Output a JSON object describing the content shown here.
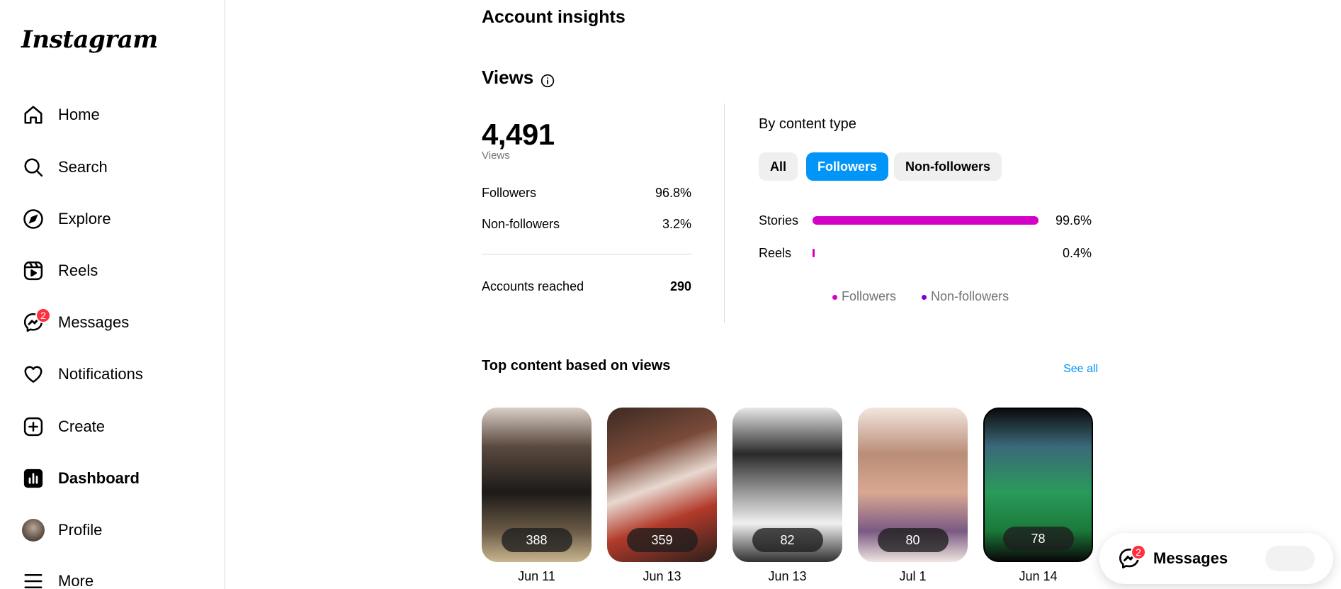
{
  "app": {
    "logo_text": "Instagram"
  },
  "sidebar": {
    "items": [
      {
        "label": "Home",
        "icon": "home-icon"
      },
      {
        "label": "Search",
        "icon": "search-icon"
      },
      {
        "label": "Explore",
        "icon": "compass-icon"
      },
      {
        "label": "Reels",
        "icon": "reels-icon"
      },
      {
        "label": "Messages",
        "icon": "messenger-icon",
        "badge": "2"
      },
      {
        "label": "Notifications",
        "icon": "heart-icon"
      },
      {
        "label": "Create",
        "icon": "plus-square-icon"
      },
      {
        "label": "Dashboard",
        "icon": "bar-chart-icon",
        "active": true
      },
      {
        "label": "Profile",
        "icon": "avatar"
      },
      {
        "label": "More",
        "icon": "menu-icon"
      }
    ]
  },
  "main": {
    "title": "Account insights",
    "views": {
      "title": "Views",
      "total": "4,491",
      "total_label": "Views",
      "followers_label": "Followers",
      "followers_value": "96.8%",
      "nonfollowers_label": "Non-followers",
      "nonfollowers_value": "3.2%",
      "reached_label": "Accounts reached",
      "reached_value": "290"
    },
    "by_content": {
      "title": "By content type",
      "pills": [
        "All",
        "Followers",
        "Non-followers"
      ],
      "selected_pill": "Followers",
      "rows": [
        {
          "name": "Stories",
          "pct": "99.6%",
          "fraction": 0.996
        },
        {
          "name": "Reels",
          "pct": "0.4%",
          "fraction": 0.004
        }
      ],
      "legend": [
        {
          "label": "Followers",
          "color": "#d300c5"
        },
        {
          "label": "Non-followers",
          "color": "#7b00d4"
        }
      ]
    },
    "top_content": {
      "title": "Top content based on views",
      "see_all": "See all",
      "items": [
        {
          "views": "388",
          "date": "Jun 11"
        },
        {
          "views": "359",
          "date": "Jun 13"
        },
        {
          "views": "82",
          "date": "Jun 13"
        },
        {
          "views": "80",
          "date": "Jul 1"
        },
        {
          "views": "78",
          "date": "Jun 14"
        }
      ]
    }
  },
  "floating_messages": {
    "label": "Messages",
    "badge": "2"
  },
  "colors": {
    "accent": "#0095f6",
    "bar": "#d300c5",
    "badge": "#ff3040"
  }
}
